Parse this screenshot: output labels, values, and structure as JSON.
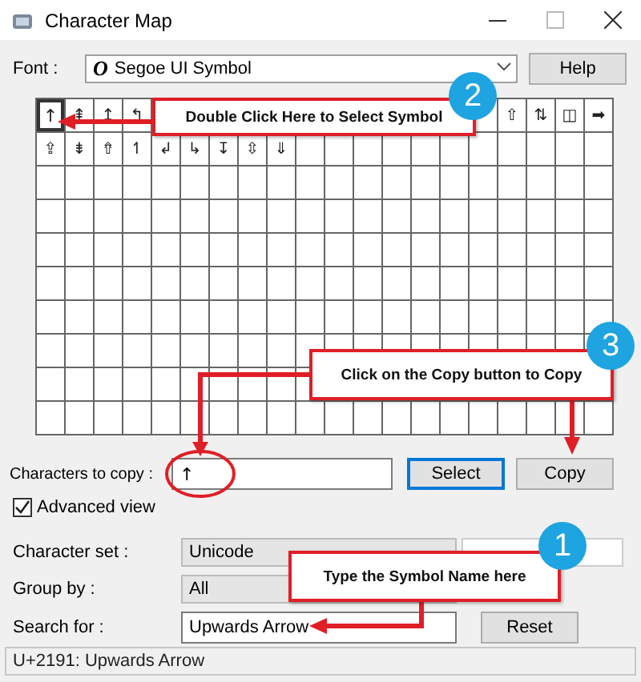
{
  "window": {
    "title": "Character Map"
  },
  "font": {
    "label": "Font :",
    "glyph": "O",
    "value": "Segoe UI Symbol"
  },
  "help_button": "Help",
  "grid": {
    "rows": [
      {
        "left": [
          {
            "char": "↑",
            "selected": true
          },
          {
            "char": "⇞",
            "selected": false
          },
          {
            "char": "↥",
            "selected": false
          },
          {
            "char": "↰",
            "selected": false
          }
        ],
        "right": [
          {
            "char": "⇧",
            "selected": false
          },
          {
            "char": "⇅",
            "selected": false
          },
          {
            "char": "◫",
            "selected": false
          },
          {
            "char": "➡",
            "selected": false
          }
        ]
      },
      {
        "left": [
          {
            "char": "⇪",
            "selected": false
          },
          {
            "char": "⇟",
            "selected": false
          },
          {
            "char": "⇮",
            "selected": false
          },
          {
            "char": "↿",
            "selected": false
          },
          {
            "char": "↲",
            "selected": false
          },
          {
            "char": "↳",
            "selected": false
          },
          {
            "char": "↧",
            "selected": false
          },
          {
            "char": "⇳",
            "selected": false
          },
          {
            "char": "⇓",
            "selected": false
          }
        ],
        "right": []
      }
    ]
  },
  "characters_to_copy": {
    "label": "Characters to copy :",
    "value": "↑"
  },
  "select_button": {
    "label": "Select",
    "default": true
  },
  "copy_button": {
    "label": "Copy",
    "default": false
  },
  "advanced_view": {
    "label": "Advanced view",
    "checked": true
  },
  "character_set": {
    "label": "Character set :",
    "value": "Unicode"
  },
  "group_by": {
    "label": "Group by :",
    "value": "All"
  },
  "search": {
    "label": "Search for :",
    "value": "Upwards Arrow"
  },
  "reset_button": "Reset",
  "status_bar": "U+2191: Upwards Arrow",
  "callouts": [
    {
      "number": "2",
      "text": "Double Click Here to Select Symbol"
    },
    {
      "number": "3",
      "text": "Click on the Copy button to Copy"
    },
    {
      "number": "1",
      "text": "Type the Symbol Name here"
    }
  ]
}
